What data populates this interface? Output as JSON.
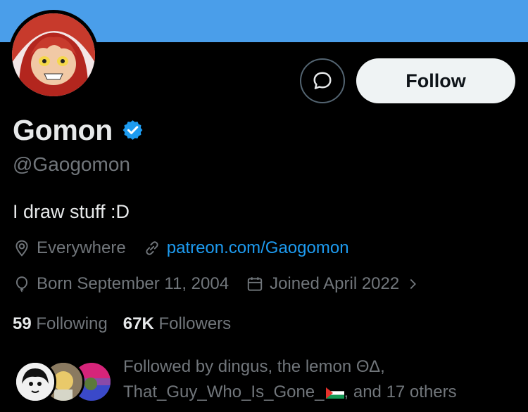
{
  "profile": {
    "display_name": "Gomon",
    "handle": "@Gaogomon",
    "bio": "I draw stuff :D",
    "location": "Everywhere",
    "website": "patreon.com/Gaogomon",
    "birthday": "Born September 11, 2004",
    "joined": "Joined April 2022"
  },
  "actions": {
    "follow_label": "Follow"
  },
  "stats": {
    "following_count": "59",
    "following_label": "Following",
    "followers_count": "67K",
    "followers_label": "Followers"
  },
  "followed_by": {
    "line1": "Followed by dingus, the lemon ΘΔ,",
    "line2_prefix": "That_Guy_Who_Is_Gone_",
    "line2_suffix": ", and 17 others"
  },
  "icons": {
    "verified": "verified-badge-icon",
    "location": "location-pin-icon",
    "link": "link-icon",
    "birthday": "balloon-icon",
    "joined": "calendar-icon",
    "message": "message-icon",
    "chevron": "chevron-right-icon"
  },
  "colors": {
    "banner": "#4a9eea",
    "accent": "#1d9bf0",
    "background": "#000000",
    "secondary_text": "#71767b"
  }
}
